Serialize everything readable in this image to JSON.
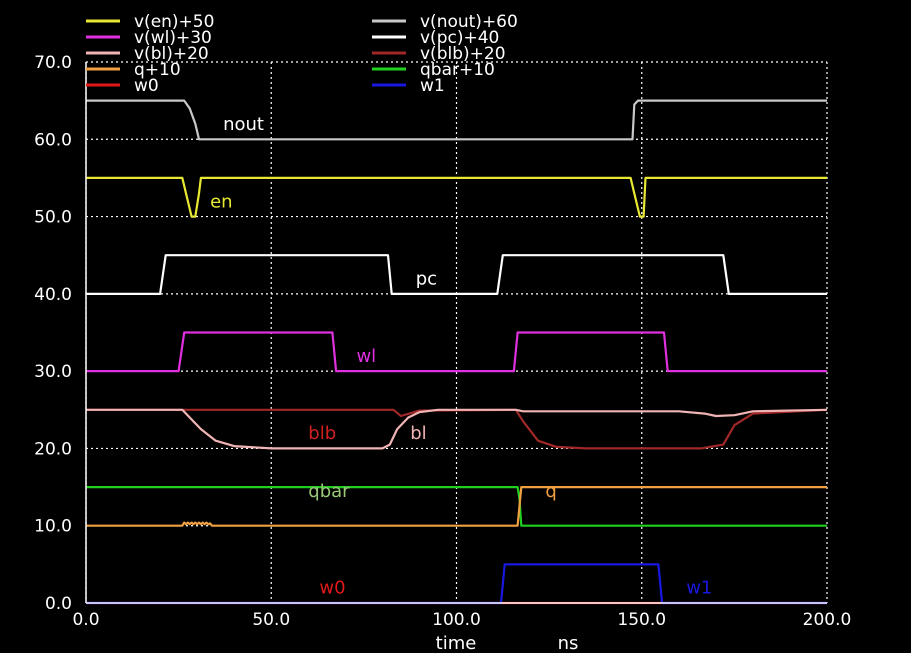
{
  "chart_data": {
    "type": "line",
    "xlabel": "time",
    "xunit": "ns",
    "xlim": [
      0,
      200
    ],
    "ylim": [
      0,
      70
    ],
    "xticks": [
      "0.0",
      "50.0",
      "100.0",
      "150.0",
      "200.0"
    ],
    "yticks": [
      "0.0",
      "10.0",
      "20.0",
      "30.0",
      "40.0",
      "50.0",
      "60.0",
      "70.0"
    ],
    "grid": true,
    "legend_position": "top",
    "legend": [
      {
        "name": "v(en)+50",
        "color": "#e8e832"
      },
      {
        "name": "v(nout)+60",
        "color": "#c8c8c8"
      },
      {
        "name": "v(wl)+30",
        "color": "#e030e0"
      },
      {
        "name": "v(pc)+40",
        "color": "#ffffff"
      },
      {
        "name": "v(bl)+20",
        "color": "#f0b4b4"
      },
      {
        "name": "v(blb)+20",
        "color": "#a02828"
      },
      {
        "name": "q+10",
        "color": "#f0a040"
      },
      {
        "name": "qbar+10",
        "color": "#20d020"
      },
      {
        "name": "w0",
        "color": "#e01818"
      },
      {
        "name": "w1",
        "color": "#1818e0"
      }
    ],
    "series": [
      {
        "name": "v(nout)+60",
        "color": "#c8c8c8",
        "x": [
          0,
          26.5,
          28,
          29.5,
          30.5,
          147.5,
          148,
          149,
          200
        ],
        "y": [
          65,
          65,
          64,
          62,
          60,
          60,
          64.5,
          65,
          65
        ]
      },
      {
        "name": "v(en)+50",
        "color": "#e8e832",
        "x": [
          0,
          26,
          27,
          28.5,
          29.5,
          30.5,
          31,
          147,
          148,
          149.5,
          150.5,
          151,
          200
        ],
        "y": [
          55,
          55,
          53,
          50,
          50,
          53,
          55,
          55,
          53,
          50,
          50,
          55,
          55
        ]
      },
      {
        "name": "v(pc)+40",
        "color": "#ffffff",
        "x": [
          0,
          20,
          21.5,
          81.5,
          82.5,
          111,
          112.5,
          172,
          173.5,
          200
        ],
        "y": [
          40,
          40,
          45,
          45,
          40,
          40,
          45,
          45,
          40,
          40
        ]
      },
      {
        "name": "v(wl)+30",
        "color": "#e030e0",
        "x": [
          0,
          25,
          26.5,
          66.5,
          67.5,
          115.5,
          116.5,
          156,
          157,
          200
        ],
        "y": [
          30,
          30,
          35,
          35,
          30,
          30,
          35,
          35,
          30,
          30
        ]
      },
      {
        "name": "v(blb)+20",
        "color": "#a02828",
        "x": [
          0,
          83,
          85,
          90,
          116,
          118,
          122,
          127,
          135,
          162,
          166,
          172,
          175,
          180,
          200
        ],
        "y": [
          25,
          25,
          24.2,
          24.9,
          25,
          23.5,
          21,
          20.2,
          20,
          20,
          20,
          20.5,
          23,
          24.5,
          25
        ]
      },
      {
        "name": "v(bl)+20",
        "color": "#f0b4b4",
        "x": [
          0,
          26,
          28,
          31,
          35,
          40,
          50,
          80,
          82,
          84,
          87,
          90,
          95,
          100,
          116,
          118,
          150,
          160,
          167,
          170,
          175,
          180,
          200
        ],
        "y": [
          25,
          25,
          24,
          22.5,
          21,
          20.3,
          20,
          20,
          20.5,
          22.5,
          24,
          24.7,
          25,
          25,
          25,
          24.8,
          24.8,
          24.8,
          24.5,
          24.2,
          24.3,
          24.8,
          25
        ]
      },
      {
        "name": "qbar+10",
        "color": "#20d020",
        "x": [
          0,
          116.5,
          117,
          117.5,
          200
        ],
        "y": [
          15,
          15,
          13.5,
          10,
          10
        ]
      },
      {
        "name": "q+10",
        "color": "#f0a040",
        "x": [
          0,
          26,
          26.5,
          27,
          27.5,
          28,
          28.5,
          29,
          29.5,
          30,
          30.5,
          31,
          31.5,
          32,
          32.5,
          33,
          33.5,
          34,
          116.5,
          117.5,
          200
        ],
        "y": [
          10,
          10,
          10.4,
          10.2,
          10.4,
          10.2,
          10.4,
          10.2,
          10.4,
          10.2,
          10.4,
          10.2,
          10.4,
          10.2,
          10.4,
          10.2,
          10.3,
          10,
          10,
          15,
          15
        ]
      },
      {
        "name": "w0",
        "color": "#e01818",
        "x": [
          0,
          200
        ],
        "y": [
          0,
          0
        ]
      },
      {
        "name": "w1",
        "color": "#1818e0",
        "x": [
          0,
          112,
          113,
          153,
          154.5,
          155.5,
          200
        ],
        "y": [
          0,
          0,
          5,
          5,
          5,
          0,
          0
        ]
      }
    ],
    "labels": [
      {
        "text": "nout",
        "x": 37,
        "y": 61.2,
        "color": "#ffffff"
      },
      {
        "text": "en",
        "x": 33.5,
        "y": 51.2,
        "color": "#e8e832"
      },
      {
        "text": "pc",
        "x": 89,
        "y": 41.2,
        "color": "#ffffff"
      },
      {
        "text": "wl",
        "x": 73,
        "y": 31.2,
        "color": "#e030e0"
      },
      {
        "text": "blb",
        "x": 60,
        "y": 21.2,
        "color": "#d02020"
      },
      {
        "text": "bl",
        "x": 87.5,
        "y": 21.2,
        "color": "#f0b4b4"
      },
      {
        "text": "qbar",
        "x": 60,
        "y": 13.7,
        "color": "#9ac87a"
      },
      {
        "text": "q",
        "x": 124,
        "y": 13.7,
        "color": "#f0a040"
      },
      {
        "text": "w0",
        "x": 63,
        "y": 1.2,
        "color": "#e01818"
      },
      {
        "text": "w1",
        "x": 162,
        "y": 1.2,
        "color": "#1818e0"
      }
    ]
  }
}
